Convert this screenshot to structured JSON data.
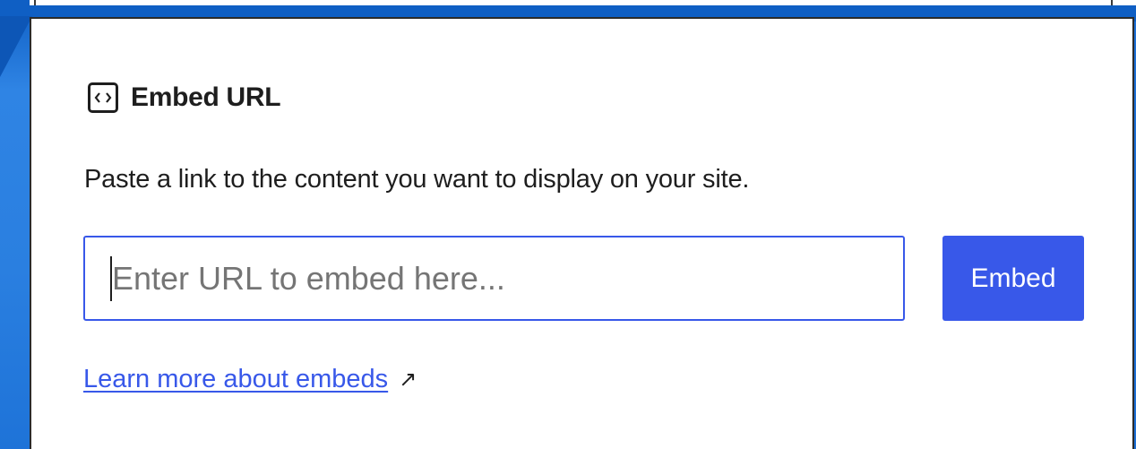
{
  "panel": {
    "title": "Embed URL",
    "icon": "embed-icon",
    "description": "Paste a link to the content you want to display on your site.",
    "url_input": {
      "value": "",
      "placeholder": "Enter URL to embed here..."
    },
    "embed_button_label": "Embed",
    "learn_more_label": "Learn more about embeds",
    "external_icon": "↗"
  },
  "colors": {
    "accent": "#3858e9",
    "text": "#1e1e1e",
    "background_blue": "#1c6fd6"
  }
}
